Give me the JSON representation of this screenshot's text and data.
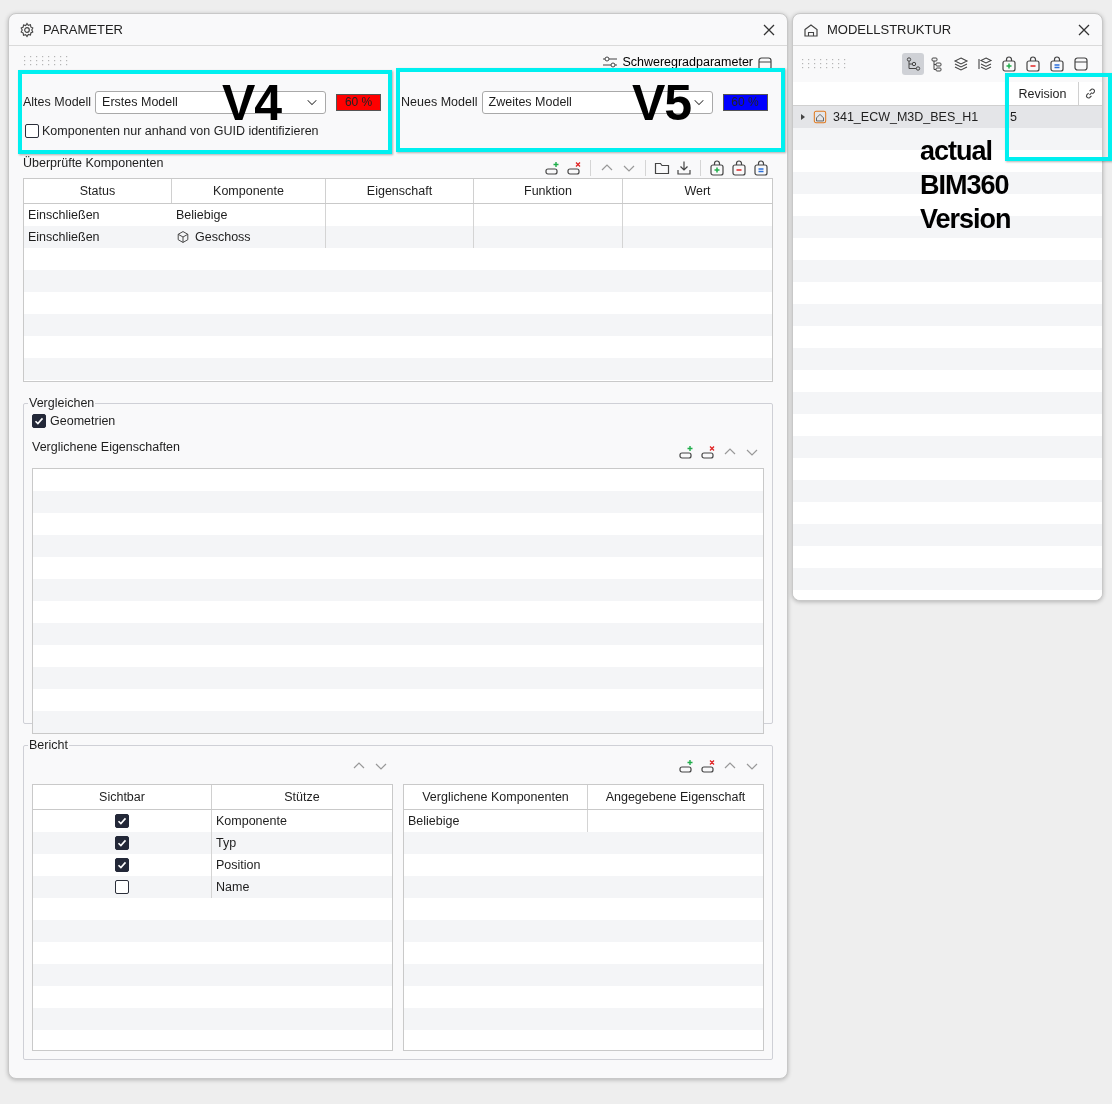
{
  "parameter_window": {
    "title": "PARAMETER",
    "severity_button": "Schweregradparameter",
    "old_model": {
      "label": "Altes Modell",
      "value": "Erstes Modell",
      "badge": "60 %",
      "color": "#ff0000"
    },
    "new_model": {
      "label": "Neues Modell",
      "value": "Zweites Modell",
      "badge": "60 %",
      "color": "#0000ff"
    },
    "guid_checkbox": {
      "label": "Komponenten nur anhand von GUID identifizieren",
      "checked": false
    },
    "checked_components": {
      "title": "Überprüfte Komponenten",
      "columns": [
        "Status",
        "Komponente",
        "Eigenschaft",
        "Funktion",
        "Wert"
      ],
      "rows": [
        {
          "status": "Einschließen",
          "component": "Beliebige",
          "kind": "plain"
        },
        {
          "status": "Einschließen",
          "component": "Geschoss",
          "kind": "level"
        }
      ]
    },
    "compare": {
      "title": "Vergleichen",
      "geometry": {
        "label": "Geometrien",
        "checked": true
      },
      "properties_label": "Verglichene Eigenschaften"
    },
    "report": {
      "title": "Bericht",
      "columns_table": {
        "columns": [
          "Sichtbar",
          "Stütze"
        ],
        "rows": [
          {
            "visible": true,
            "column": "Komponente"
          },
          {
            "visible": true,
            "column": "Typ"
          },
          {
            "visible": true,
            "column": "Position"
          },
          {
            "visible": false,
            "column": "Name"
          }
        ]
      },
      "components_table": {
        "columns": [
          "Verglichene Komponenten",
          "Angegebene Eigenschaft"
        ],
        "rows": [
          {
            "component": "Beliebige"
          }
        ]
      }
    }
  },
  "model_structure_window": {
    "title": "MODELLSTRUKTUR",
    "tools": [
      {
        "selected": true
      },
      {
        "selected": false
      },
      {
        "selected": false
      },
      {
        "selected": false
      },
      {
        "selected": false
      },
      {
        "selected": false
      },
      {
        "selected": false
      },
      {
        "selected": false
      }
    ],
    "columns": [
      "Revision"
    ],
    "rows": [
      {
        "name": "341_ECW_M3D_BES_H1",
        "revision": "5",
        "expanded": false,
        "selected": true
      }
    ]
  },
  "annotations": [
    {
      "text": "V4"
    },
    {
      "text": "V5"
    },
    {
      "text": "actual BIM360 Version"
    }
  ]
}
